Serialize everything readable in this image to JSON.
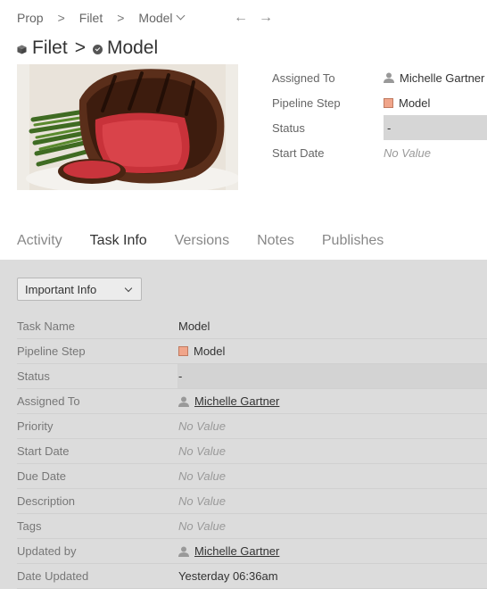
{
  "breadcrumb": {
    "items": [
      "Prop",
      "Filet",
      "Model"
    ],
    "separator": ">"
  },
  "title": {
    "parent": "Filet",
    "separator": ">",
    "name": "Model"
  },
  "thumbnail": {
    "icon": "steak-photo"
  },
  "summary": {
    "rows": [
      {
        "label": "Assigned To",
        "value": "Michelle Gartner"
      },
      {
        "label": "Pipeline Step",
        "value": "Model"
      },
      {
        "label": "Status",
        "value": "-"
      },
      {
        "label": "Start Date",
        "value": "No Value"
      }
    ]
  },
  "tabs": [
    "Activity",
    "Task Info",
    "Versions",
    "Notes",
    "Publishes"
  ],
  "active_tab": "Task Info",
  "panel": {
    "dropdown_label": "Important Info",
    "fields": [
      {
        "label": "Task Name",
        "value": "Model"
      },
      {
        "label": "Pipeline Step",
        "value": "Model"
      },
      {
        "label": "Status",
        "value": "-"
      },
      {
        "label": "Assigned To",
        "value": "Michelle Gartner"
      },
      {
        "label": "Priority",
        "value": "No Value"
      },
      {
        "label": "Start Date",
        "value": "No Value"
      },
      {
        "label": "Due Date",
        "value": "No Value"
      },
      {
        "label": "Description",
        "value": "No Value"
      },
      {
        "label": "Tags",
        "value": "No Value"
      },
      {
        "label": "Updated by",
        "value": "Michelle Gartner"
      },
      {
        "label": "Date Updated",
        "value": "Yesterday 06:36am"
      }
    ]
  },
  "colors": {
    "pipeline_step_swatch": "#f0a58a",
    "panel_background": "#dcdcdc"
  }
}
